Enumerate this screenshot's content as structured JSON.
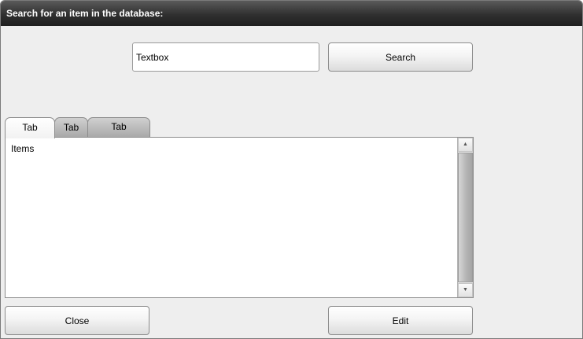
{
  "window": {
    "title": "Search for an item in the database:"
  },
  "search": {
    "value": "Textbox",
    "button_label": "Search"
  },
  "tabs": [
    {
      "label": "Tab"
    },
    {
      "label": "Tab"
    },
    {
      "label": "Tab"
    }
  ],
  "list": {
    "items": [
      "Items"
    ]
  },
  "scrollbar": {
    "up_icon": "triangle-up-icon",
    "down_icon": "triangle-down-icon"
  },
  "footer": {
    "close_label": "Close",
    "edit_label": "Edit"
  },
  "colors": {
    "titlebar": "#303030",
    "window_bg": "#eeeeee",
    "inactive_tab": "#b5b5b5"
  }
}
